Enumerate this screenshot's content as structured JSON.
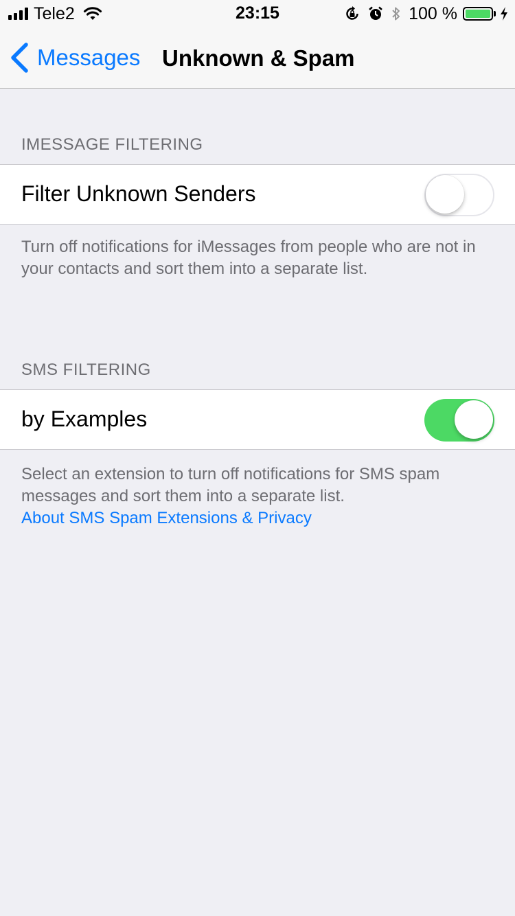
{
  "status_bar": {
    "carrier": "Tele2",
    "time": "23:15",
    "battery_percent": "100 %",
    "icons": [
      "signal-icon",
      "wifi-icon",
      "rotation-lock-icon",
      "alarm-icon",
      "bluetooth-icon",
      "battery-icon",
      "charging-icon"
    ],
    "battery_color": "#4cd964"
  },
  "nav": {
    "back_label": "Messages",
    "title": "Unknown & Spam",
    "accent": "#0a7aff"
  },
  "imessage_section": {
    "header": "IMESSAGE FILTERING",
    "row_label": "Filter Unknown Senders",
    "toggle_on": false,
    "footer": "Turn off notifications for iMessages from people who are not in your contacts and sort them into a separate list."
  },
  "sms_section": {
    "header": "SMS FILTERING",
    "row_label": "by Examples",
    "toggle_on": true,
    "footer": "Select an extension to turn off notifications for SMS spam messages and sort them into a separate list.",
    "footer_link": "About SMS Spam Extensions & Privacy"
  }
}
